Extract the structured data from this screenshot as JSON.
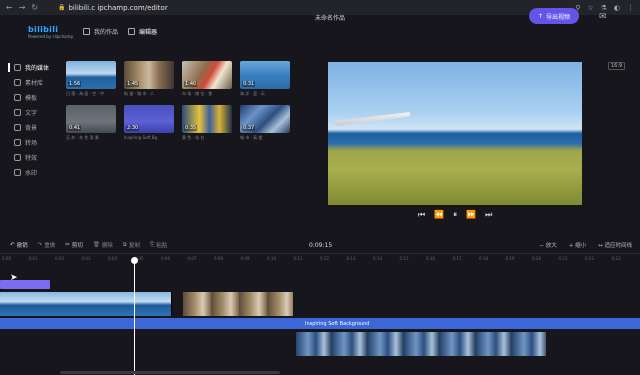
{
  "browser": {
    "url": "bilibili.c ipchamp.com/editor",
    "nav_back": "←",
    "nav_forward": "→",
    "nav_reload": "↻",
    "lock": "🔒",
    "actions": [
      "⚲",
      "☆",
      "⚗",
      "◐",
      "⋮"
    ]
  },
  "app": {
    "logo": "bilibili",
    "logo_sub": "Powered by clipchamp",
    "menu_icon": "page-icon",
    "menu_1": "我的作品",
    "menu_2": "编辑器",
    "project_title": "未命名作品",
    "export_label": "导出视频",
    "export_icon": "↑"
  },
  "sidebar": {
    "items": [
      {
        "label": "我的媒体",
        "icon": "media-icon"
      },
      {
        "label": "素材库",
        "icon": "library-icon"
      },
      {
        "label": "模板",
        "icon": "template-icon"
      },
      {
        "label": "文字",
        "icon": "text-icon"
      },
      {
        "label": "背景",
        "icon": "background-icon"
      },
      {
        "label": "转场",
        "icon": "transition-icon"
      },
      {
        "label": "特效",
        "icon": "effect-icon"
      },
      {
        "label": "水印",
        "icon": "watermark-icon"
      }
    ]
  },
  "media": {
    "tiles": [
      {
        "duration": "1:56",
        "caption": "日 落 · 海 面 · 空 · 中"
      },
      {
        "duration": "1:45",
        "caption": "街 道 · 城 市 · 人"
      },
      {
        "duration": "1:40",
        "caption": "市 场 · 摊 位 · 食"
      },
      {
        "duration": "0:31",
        "caption": "海 洋 · 蓝 · 天"
      },
      {
        "duration": "0:41",
        "caption": "石 灰 · 灰 色 背 景"
      },
      {
        "duration": "2:30",
        "caption": "Inspiring Soft Bg"
      },
      {
        "duration": "0:35",
        "caption": "黄 色 · 站 台"
      },
      {
        "duration": "0:37",
        "caption": "城 市 · 高 楼"
      }
    ]
  },
  "preview": {
    "aspect": "16:9",
    "controls": [
      "⏮",
      "⏪",
      "⏸",
      "⏩",
      "⏭"
    ]
  },
  "toolbar": {
    "undo": "撤销",
    "redo": "重做",
    "cut": "剪切",
    "delete": "删除",
    "copy": "复制",
    "more": "粘贴",
    "timecode": "0:09:15",
    "zoom_in": "放大",
    "zoom_out": "缩小",
    "fit": "适应时间线"
  },
  "timeline": {
    "ticks": [
      "0:00",
      "0:01",
      "0:02",
      "0:03",
      "0:04",
      "0:05",
      "0:06",
      "0:07",
      "0:08",
      "0:09",
      "0:10",
      "0:11",
      "0:12",
      "0:13",
      "0:14",
      "0:15",
      "0:16",
      "0:17",
      "0:18",
      "0:19",
      "0:20",
      "0:21",
      "0:22",
      "0:23"
    ],
    "audio_label": "Inspiring Soft Background"
  }
}
